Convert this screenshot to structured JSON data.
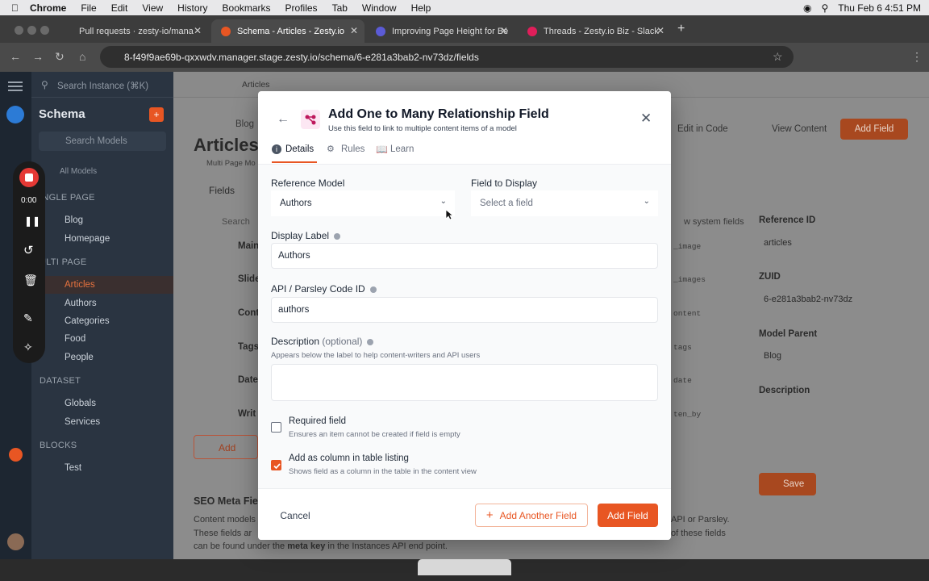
{
  "menubar": {
    "app": "Chrome",
    "items": [
      "File",
      "Edit",
      "View",
      "History",
      "Bookmarks",
      "Profiles",
      "Tab",
      "Window",
      "Help"
    ],
    "clock": "Thu Feb 6  4:51 PM"
  },
  "tabs": [
    {
      "title": "Pull requests · zesty-io/mana",
      "active": false,
      "color": "#5e5e5e"
    },
    {
      "title": "Schema - Articles - Zesty.io",
      "active": true,
      "color": "#e85623"
    },
    {
      "title": "Improving Page Height for Be",
      "active": false,
      "color": "#5b5bd6"
    },
    {
      "title": "Threads - Zesty.io Biz - Slack",
      "active": false,
      "color": "#e01e5a"
    }
  ],
  "url": "8-f49f9ae69b-qxxwdv.manager.stage.zesty.io/schema/6-e281a3bab2-nv73dz/fields",
  "app": {
    "search_placeholder": "Search Instance (⌘K)",
    "breadcrumb_tab": "Articles",
    "sidebar": {
      "title": "Schema",
      "search": "Search Models",
      "all_models": "All Models",
      "single_page": "INGLE PAGE",
      "single_items": [
        "Blog",
        "Homepage"
      ],
      "multi_page": "ULTI PAGE",
      "multi_items": [
        "Articles",
        "Authors",
        "Categories",
        "Food",
        "People"
      ],
      "dataset": "DATASET",
      "dataset_items": [
        "Globals",
        "Services"
      ],
      "blocks": "BLOCKS",
      "block_items": [
        "Test"
      ]
    },
    "main": {
      "crumb": "Blog",
      "title": "Articles",
      "subtitle": "Multi Page Mo",
      "fields_tab": "Fields",
      "search": "Search",
      "rows": [
        "Main",
        "Slide",
        "Cont",
        "Tags",
        "Date",
        "Writ"
      ],
      "row_codes": [
        "_image",
        "_images",
        "ontent",
        "tags",
        "date",
        "ten_by"
      ],
      "add": "Add",
      "show_system": "w system fields",
      "edit_in_code": "Edit in Code",
      "view_content": "View Content",
      "add_field": "Add Field",
      "seo_title": "SEO Meta Fie",
      "seo_text_1": "Content models",
      "seo_text_2": "These fields ar",
      "seo_text_3_a": "can be found under the ",
      "seo_text_3_b": "meta key",
      "seo_text_3_c": " in the Instances API end point.",
      "seo_right_1": "API or Parsley.",
      "seo_right_2": "of these fields"
    },
    "right_panel": {
      "ref_id_label": "Reference ID",
      "ref_id": "articles",
      "zuid_label": "ZUID",
      "zuid": "6-e281a3bab2-nv73dz",
      "parent_label": "Model Parent",
      "parent": "Blog",
      "desc_label": "Description",
      "save": "Save"
    }
  },
  "recorder": {
    "time": "0:00"
  },
  "modal": {
    "title": "Add One to Many Relationship Field",
    "subtitle": "Use this field to link to multiple content items of a model",
    "tabs": [
      "Details",
      "Rules",
      "Learn"
    ],
    "reference_model_label": "Reference Model",
    "reference_model_value": "Authors",
    "field_to_display_label": "Field to Display",
    "field_to_display_placeholder": "Select a field",
    "display_label_label": "Display Label",
    "display_label_value": "Authors",
    "api_id_label": "API / Parsley Code ID",
    "api_id_value": "authors",
    "description_label": "Description",
    "description_optional": "(optional)",
    "description_help": "Appears below the label to help content-writers and API users",
    "required_label": "Required field",
    "required_help": "Ensures an item cannot be created if field is empty",
    "required_checked": false,
    "column_label": "Add as column in table listing",
    "column_help": "Shows field as a column in the table in the content view",
    "column_checked": true,
    "cancel": "Cancel",
    "add_another": "Add Another Field",
    "add_field": "Add Field",
    "accent": "#e85623"
  }
}
